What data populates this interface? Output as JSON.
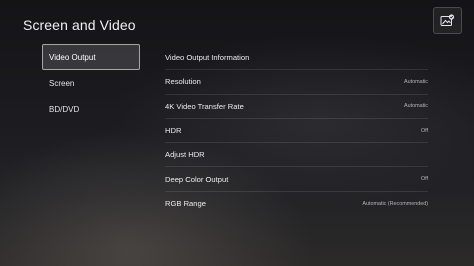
{
  "header": {
    "title": "Screen and Video",
    "corner_icon": "image-check-icon"
  },
  "sidebar": {
    "items": [
      {
        "label": "Video Output",
        "selected": true
      },
      {
        "label": "Screen",
        "selected": false
      },
      {
        "label": "BD/DVD",
        "selected": false
      }
    ]
  },
  "settings": {
    "rows": [
      {
        "label": "Video Output Information",
        "value": ""
      },
      {
        "label": "Resolution",
        "value": "Automatic"
      },
      {
        "label": "4K Video Transfer Rate",
        "value": "Automatic"
      },
      {
        "label": "HDR",
        "value": "Off"
      },
      {
        "label": "Adjust HDR",
        "value": ""
      },
      {
        "label": "Deep Color Output",
        "value": "Off"
      },
      {
        "label": "RGB Range",
        "value": "Automatic (Recommended)"
      }
    ]
  },
  "colors": {
    "background": "#1c1c20",
    "selected_border": "#ffffff",
    "text": "#ededef",
    "value_text": "#b6b6ba"
  }
}
